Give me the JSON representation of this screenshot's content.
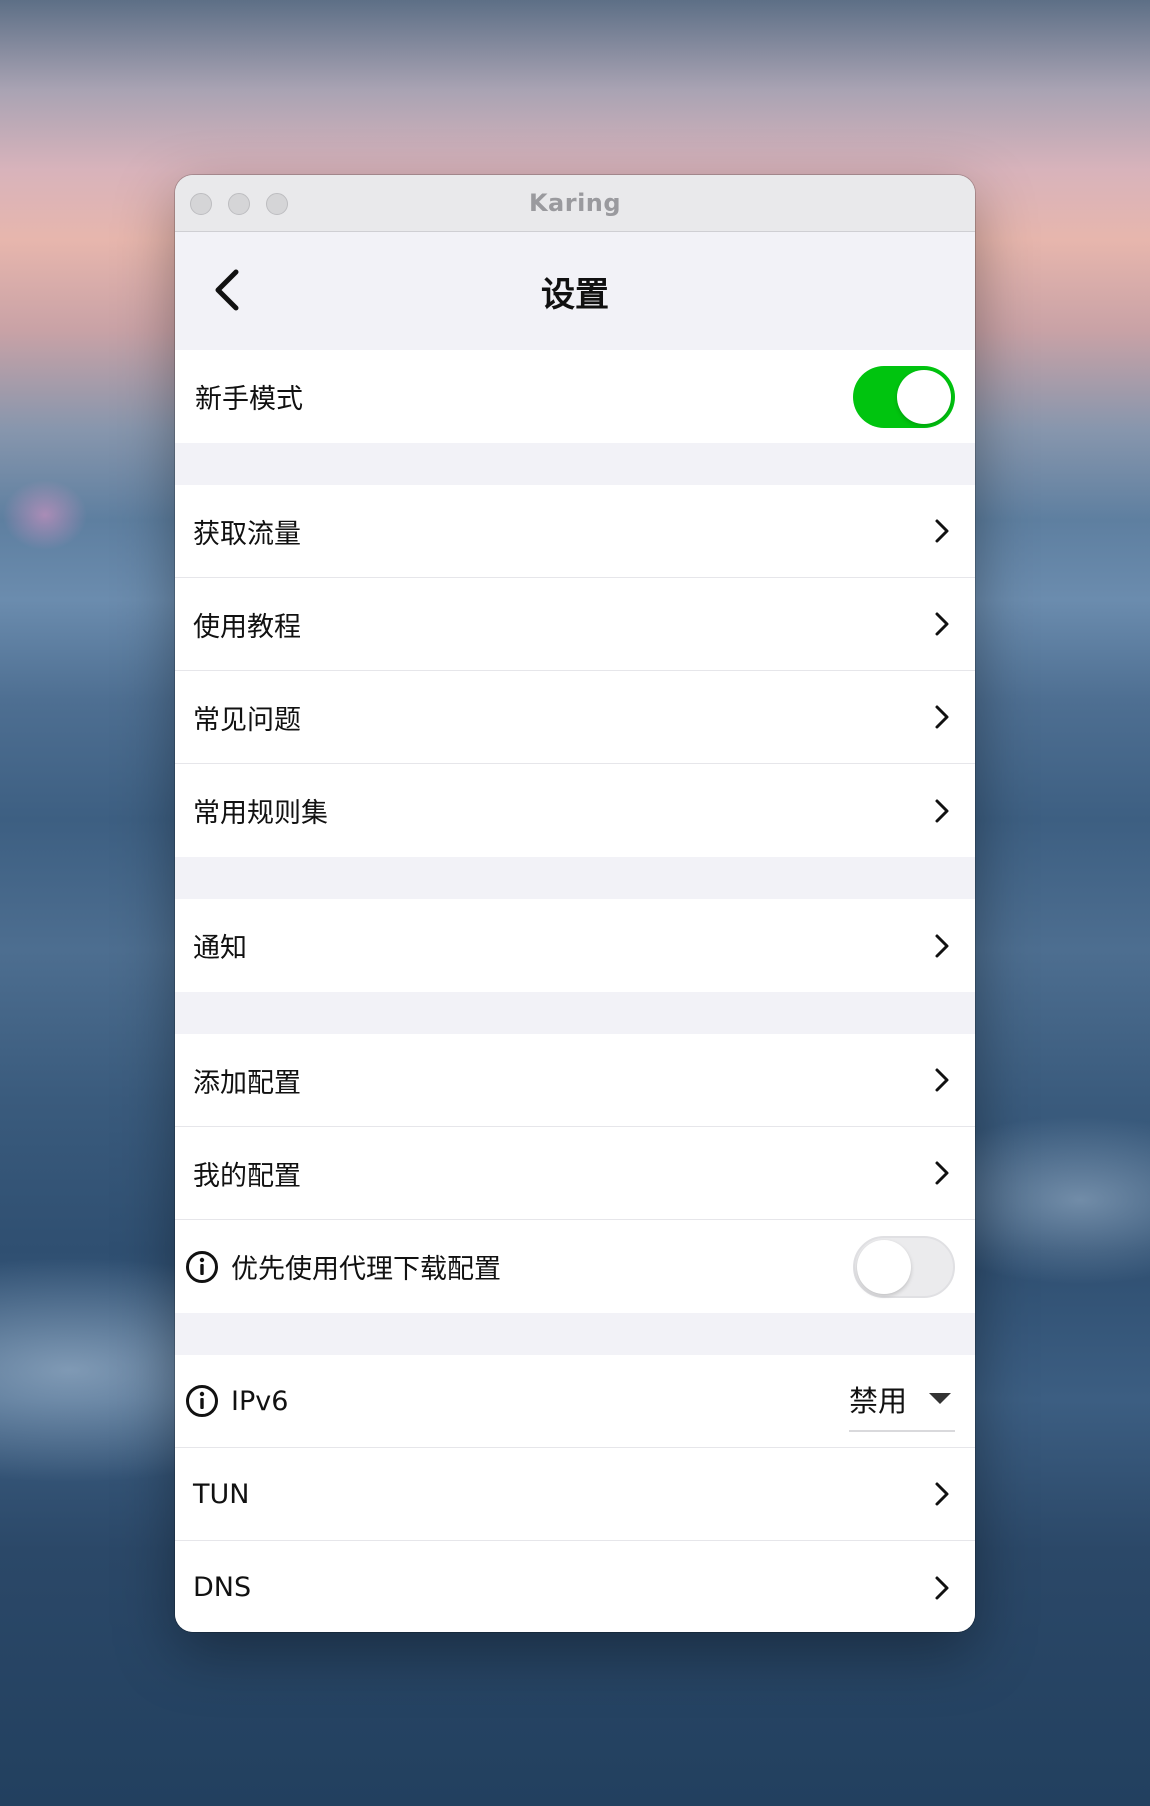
{
  "window": {
    "title": "Karing"
  },
  "header": {
    "title": "设置"
  },
  "sections": {
    "beginner": {
      "label": "新手模式",
      "toggle_on": true
    },
    "get_traffic": {
      "label": "获取流量"
    },
    "tutorial": {
      "label": "使用教程"
    },
    "faq": {
      "label": "常见问题"
    },
    "rulesets": {
      "label": "常用规则集"
    },
    "notifications": {
      "label": "通知"
    },
    "add_config": {
      "label": "添加配置"
    },
    "my_config": {
      "label": "我的配置"
    },
    "proxy_download": {
      "label": "优先使用代理下载配置",
      "toggle_on": false
    },
    "ipv6": {
      "label": "IPv6",
      "value": "禁用"
    },
    "tun": {
      "label": "TUN"
    },
    "dns": {
      "label": "DNS"
    }
  },
  "colors": {
    "toggle_on": "#00c40f",
    "toggle_off": "#ebebed",
    "group_gap": "#f2f2f7"
  },
  "icons": {
    "back": "chevron-left-icon",
    "row_nav": "chevron-right-icon",
    "info": "info-circle-icon",
    "dropdown": "caret-down-icon"
  }
}
